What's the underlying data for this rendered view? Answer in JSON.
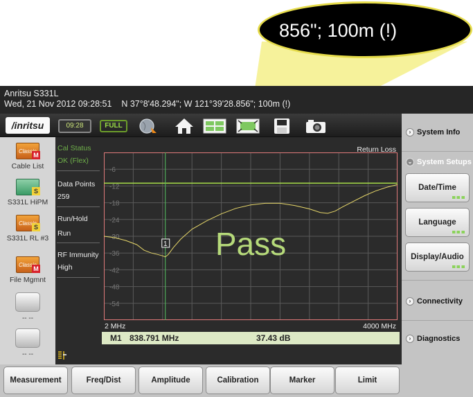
{
  "zoom_callout": {
    "text": "856\"; 100m (!)"
  },
  "header": {
    "device_name": "Anritsu S331L",
    "datetime_gps": "Wed, 21 Nov 2012 09:28:51    N 37°8'48.294\"; W 121°39'28.856\"; 100m (!)"
  },
  "toolbar": {
    "logo": "/inritsu",
    "clock": "09:28",
    "battery": "FULL"
  },
  "apps": [
    {
      "label": "Cable List",
      "badge": "M",
      "icon": "classic-app-icon"
    },
    {
      "label": "S331L HiPM",
      "badge": "S",
      "icon": "hipm-app-icon"
    },
    {
      "label": "S331L RL #3",
      "badge": "S",
      "icon": "classic-app-icon"
    },
    {
      "label": "File Mgmnt",
      "badge": "M",
      "icon": "classic-app-icon"
    },
    {
      "label": "-- --",
      "icon": "empty-slot"
    },
    {
      "label": "-- --",
      "icon": "empty-slot"
    }
  ],
  "status_panel": {
    "cal_status_label": "Cal Status",
    "cal_status_value": "OK (Flex)",
    "data_points_label": "Data Points",
    "data_points_value": "259",
    "run_hold_label": "Run/Hold",
    "run_hold_value": "Run",
    "rf_immunity_label": "RF Immunity",
    "rf_immunity_value": "High"
  },
  "chart": {
    "title": "Return Loss",
    "pass_text": "Pass",
    "marker_label": "1",
    "x_start": "2 MHz",
    "x_stop": "4000 MHz"
  },
  "chart_data": {
    "type": "line",
    "title": "Return Loss",
    "xlim": [
      2,
      4000
    ],
    "ylim": [
      0,
      -60
    ],
    "ytick_labels": [
      "-6",
      "-12",
      "-18",
      "-24",
      "-30",
      "-36",
      "-42",
      "-48",
      "-54"
    ],
    "limit_line": -11,
    "marker": {
      "x": 838.791,
      "y": -37.43
    },
    "series": [
      {
        "x": [
          2,
          150,
          300,
          450,
          550,
          650,
          730,
          800,
          838.8,
          880,
          950,
          1050,
          1200,
          1400,
          1600,
          1800,
          2000,
          2200,
          2400,
          2600,
          2800,
          2950,
          3050,
          3150,
          3250,
          3400,
          3550,
          3700,
          3850,
          4000
        ],
        "y": [
          -30,
          -30.5,
          -31.5,
          -33,
          -35,
          -36,
          -36.5,
          -37,
          -37.4,
          -36.5,
          -34,
          -31,
          -27.5,
          -24.5,
          -22,
          -20,
          -18.8,
          -18.2,
          -18.2,
          -19,
          -20.2,
          -21.5,
          -21.8,
          -21,
          -19.5,
          -17.5,
          -15.5,
          -13.8,
          -12.5,
          -11.5
        ]
      }
    ],
    "grid": true
  },
  "marker_readout": {
    "name": "M1",
    "frequency": "838.791 MHz",
    "value": "37.43 dB"
  },
  "right_menu": {
    "system_info": "System Info",
    "system_setups": "System Setups",
    "date_time": "Date/Time",
    "language": "Language",
    "display_audio": "Display/Audio",
    "connectivity": "Connectivity",
    "diagnostics": "Diagnostics"
  },
  "bottom_menu": [
    "Measurement",
    "Freq/Dist",
    "Amplitude",
    "Calibration",
    "Marker",
    "Limit"
  ],
  "colors": {
    "trace": "#e8d86a",
    "limit_line": "#a9e04a",
    "grid": "#5a5a5a",
    "plot_border": "#e07a7a",
    "marker_line": "#55c060",
    "pass_text": "#b6da7a"
  }
}
